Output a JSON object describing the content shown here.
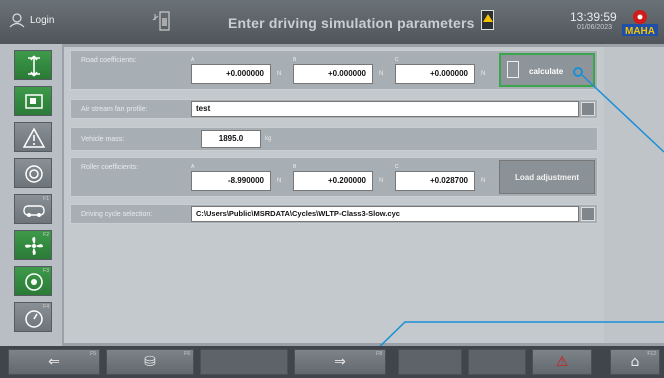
{
  "header": {
    "login_label": "Login",
    "title": "Enter driving simulation parameters",
    "time": "13:39:59",
    "date": "01/06/2023",
    "logo_text": "MAHA"
  },
  "sidebar": {
    "items": [
      {
        "icon": "lift-icon",
        "num": ""
      },
      {
        "icon": "monitor-icon",
        "num": ""
      },
      {
        "icon": "warning-icon",
        "num": ""
      },
      {
        "icon": "brake-icon",
        "num": ""
      },
      {
        "icon": "car-icon",
        "num": "F1"
      },
      {
        "icon": "fan-icon",
        "num": "F2"
      },
      {
        "icon": "rotate-icon",
        "num": "F3"
      },
      {
        "icon": "gauge-icon",
        "num": "F4"
      }
    ]
  },
  "form": {
    "road_label": "Road coefficients:",
    "road": {
      "a_sub": "A",
      "a_value": "+0.000000",
      "a_unit": "N",
      "b_sub": "B",
      "b_value": "+0.000000",
      "b_unit": "N",
      "c_sub": "C",
      "c_value": "+0.000000",
      "c_unit": "N"
    },
    "calculate_label": "calculate",
    "airstream_label": "Air stream fan profile:",
    "airstream_value": "test",
    "mass_label": "Vehicle mass:",
    "mass_value": "1895.0",
    "mass_unit": "kg",
    "roller_label": "Roller coefficients:",
    "roller": {
      "a_sub": "A",
      "a_value": "-8.990000",
      "a_unit": "N",
      "b_sub": "B",
      "b_value": "+0.200000",
      "b_unit": "N",
      "c_sub": "C",
      "c_value": "+0.028700",
      "c_unit": "N"
    },
    "load_adjustment_label": "Load adjustment",
    "cycle_label": "Driving cycle selection:",
    "cycle_value": "C:\\Users\\Public\\MSRDATA\\Cycles\\WLTP-Class3-Slow.cyc"
  },
  "bottom": {
    "buttons": [
      {
        "glyph": "⇐",
        "num": "F5"
      },
      {
        "glyph": "⛁",
        "num": "F6"
      },
      {
        "glyph": "",
        "num": ""
      },
      {
        "glyph": "⇒",
        "num": "F8"
      },
      {
        "glyph": "",
        "num": ""
      },
      {
        "glyph": "",
        "num": ""
      },
      {
        "glyph": "⚠",
        "num": ""
      },
      {
        "glyph": "⌂",
        "num": "F12"
      }
    ]
  },
  "colors": {
    "accent_green": "#3aa54a",
    "callout_blue": "#1a8fd6",
    "warning_red": "#d11a1a"
  }
}
